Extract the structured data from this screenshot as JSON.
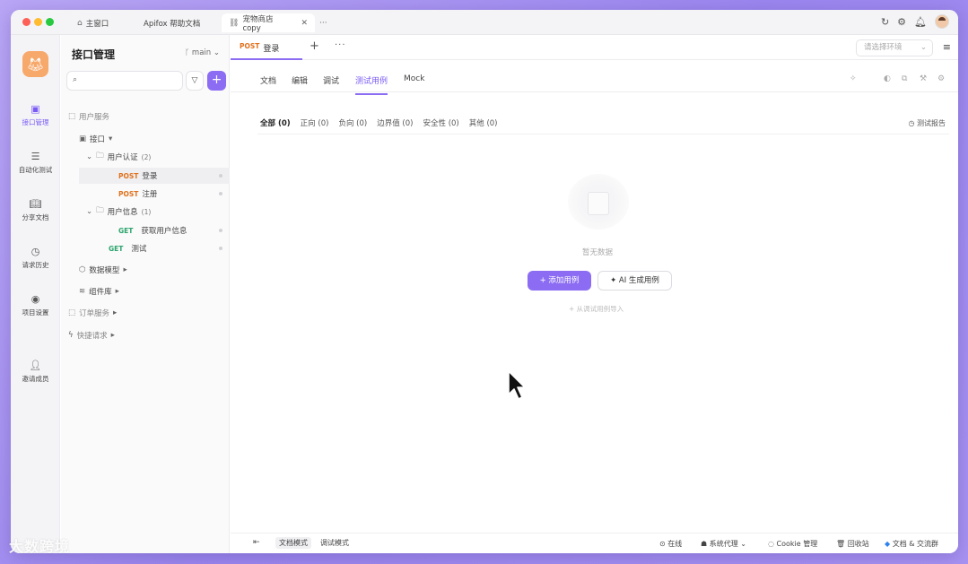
{
  "window_tabs": [
    {
      "label": "主窗口"
    },
    {
      "label": "Apifox 帮助文档"
    },
    {
      "label": "宠物商店 copy"
    }
  ],
  "rail": {
    "items": [
      {
        "label": "接口管理"
      },
      {
        "label": "自动化测试"
      },
      {
        "label": "分享文档"
      },
      {
        "label": "请求历史"
      },
      {
        "label": "项目设置"
      },
      {
        "label": "邀请成员"
      }
    ]
  },
  "sidebar": {
    "title": "接口管理",
    "branch": "main",
    "search_placeholder": "",
    "add_label": "+",
    "tree": {
      "user_service": "用户服务",
      "interface": "接口",
      "auth_folder": "用户认证",
      "auth_count": "(2)",
      "login_method": "POST",
      "login_name": "登录",
      "register_method": "POST",
      "register_name": "注册",
      "info_folder": "用户信息",
      "info_count": "(1)",
      "getinfo_method": "GET",
      "getinfo_name": "获取用户信息",
      "test_method": "GET",
      "test_name": "测试",
      "data_model": "数据模型",
      "components": "组件库",
      "order_service": "订单服务",
      "quick_request": "快捷请求"
    }
  },
  "main": {
    "request_tab": {
      "method": "POST",
      "name": "登录"
    },
    "env_placeholder": "请选择环境",
    "subtabs": [
      "文档",
      "编辑",
      "调试",
      "测试用例",
      "Mock"
    ],
    "active_subtab": "测试用例",
    "filters": [
      {
        "label": "全部",
        "count": "(0)"
      },
      {
        "label": "正向",
        "count": "(0)"
      },
      {
        "label": "负向",
        "count": "(0)"
      },
      {
        "label": "边界值",
        "count": "(0)"
      },
      {
        "label": "安全性",
        "count": "(0)"
      },
      {
        "label": "其他",
        "count": "(0)"
      }
    ],
    "report_label": "测试报告",
    "empty_text": "暂无数据",
    "add_case_label": "+ 添加用例",
    "ai_generate_label": "AI 生成用例",
    "import_link": "+ 从调试用例导入"
  },
  "statusbar": {
    "doc_mode": "文档模式",
    "debug_mode": "调试模式",
    "online": "在线",
    "proxy": "系统代理",
    "cookie": "Cookie 管理",
    "recycle": "回收站",
    "docs_community": "文档 & 交流群"
  },
  "watermark": "大数跨境",
  "colors": {
    "accent": "#8b6cf3",
    "post": "#e0711c",
    "get": "#2aa36b"
  }
}
